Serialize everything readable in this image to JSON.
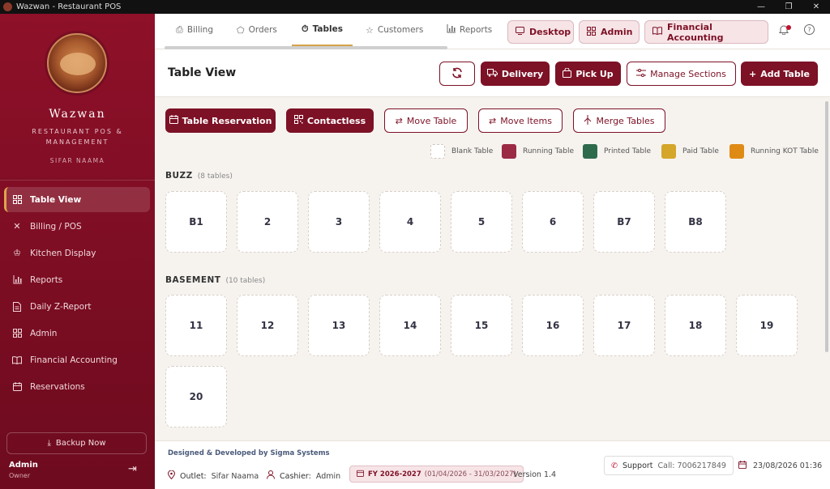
{
  "window": {
    "title": "Wazwan - Restaurant POS"
  },
  "sidebar": {
    "brand": "Wazwan",
    "subtitle": "RESTAURANT POS & MANAGEMENT",
    "owner": "SIFAR NAAMA",
    "items": [
      {
        "label": "Table View",
        "icon": "grid-icon",
        "active": true
      },
      {
        "label": "Billing / POS",
        "icon": "utensils-icon"
      },
      {
        "label": "Kitchen Display",
        "icon": "chef-hat-icon"
      },
      {
        "label": "Reports",
        "icon": "bar-chart-icon"
      },
      {
        "label": "Daily Z-Report",
        "icon": "document-icon"
      },
      {
        "label": "Admin",
        "icon": "grid-icon"
      },
      {
        "label": "Financial Accounting",
        "icon": "book-icon"
      },
      {
        "label": "Reservations",
        "icon": "calendar-icon"
      }
    ],
    "backup_label": "Backup Now",
    "user": {
      "name": "Admin",
      "role": "Owner"
    }
  },
  "topnav": {
    "tabs": [
      {
        "label": "Billing",
        "icon": "printer-icon"
      },
      {
        "label": "Orders",
        "icon": "tag-icon"
      },
      {
        "label": "Tables",
        "icon": "timer-icon",
        "active": true
      },
      {
        "label": "Customers",
        "icon": "star-icon"
      },
      {
        "label": "Reports",
        "icon": "bar-chart-icon"
      }
    ],
    "pills": [
      {
        "label": "Desktop",
        "icon": "monitor-icon"
      },
      {
        "label": "Admin",
        "icon": "grid-icon"
      },
      {
        "label": "Financial Accounting",
        "icon": "book-icon"
      }
    ]
  },
  "header": {
    "title": "Table View",
    "buttons": {
      "delivery": "Delivery",
      "pickup": "Pick Up",
      "manage_sections": "Manage Sections",
      "add_table": "Add Table"
    }
  },
  "actions": {
    "table_reservation": "Table Reservation",
    "contactless": "Contactless",
    "move_table": "Move Table",
    "move_items": "Move Items",
    "merge_tables": "Merge Tables"
  },
  "legend": [
    {
      "label": "Blank Table",
      "color": "#ffffff"
    },
    {
      "label": "Running Table",
      "color": "#9b2a45"
    },
    {
      "label": "Printed Table",
      "color": "#2e6b4c"
    },
    {
      "label": "Paid Table",
      "color": "#d4a62a"
    },
    {
      "label": "Running KOT Table",
      "color": "#e08a16"
    }
  ],
  "sections": [
    {
      "name": "BUZZ",
      "count": "(8 tables)",
      "tables": [
        "B1",
        "2",
        "3",
        "4",
        "5",
        "6",
        "B7",
        "B8"
      ]
    },
    {
      "name": "BASEMENT",
      "count": "(10 tables)",
      "tables": [
        "11",
        "12",
        "13",
        "14",
        "15",
        "16",
        "17",
        "18",
        "19",
        "20"
      ]
    }
  ],
  "footer": {
    "credit": "Designed & Developed by Sigma Systems",
    "outlet_label": "Outlet:",
    "outlet": "Sifar Naama",
    "cashier_label": "Cashier:",
    "cashier": "Admin",
    "fy": "FY 2026-2027",
    "fy_range": "(01/04/2026 - 31/03/2027)",
    "version": "Version 1.4",
    "support_label": "Support",
    "support_call": "Call: 7006217849",
    "datetime": "23/08/2026 01:36"
  },
  "colors": {
    "primary": "#7d1126",
    "accent": "#d4a24a"
  }
}
